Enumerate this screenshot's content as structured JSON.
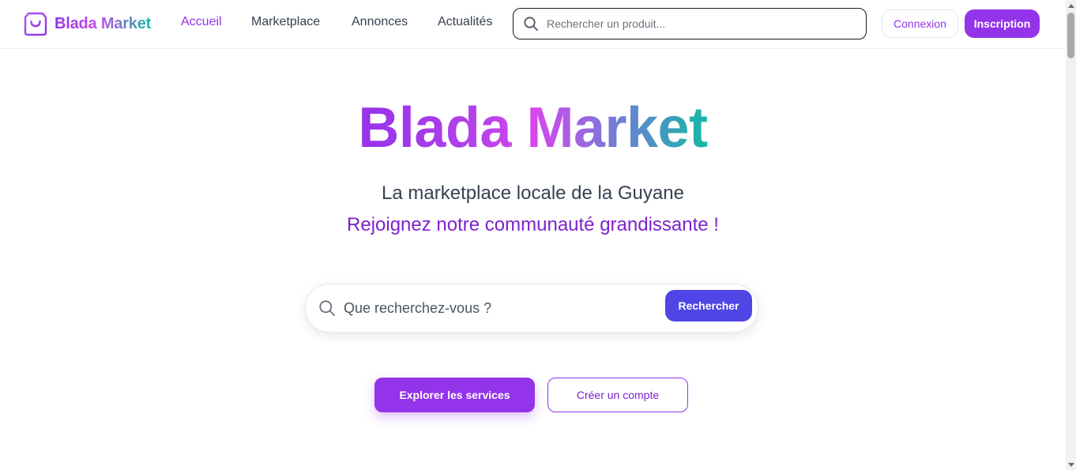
{
  "header": {
    "brand": "Blada Market",
    "nav": {
      "home": "Accueil",
      "marketplace": "Marketplace",
      "listings": "Annonces",
      "news": "Actualités"
    },
    "search": {
      "placeholder": "Rechercher un produit..."
    },
    "login_label": "Connexion",
    "signup_label": "Inscription"
  },
  "hero": {
    "title": "Blada Market",
    "subtitle": "La marketplace locale de la Guyane",
    "tagline": "Rejoignez notre communauté grandissante !",
    "search": {
      "placeholder": "Que recherchez-vous ?",
      "button_label": "Rechercher"
    },
    "explore_label": "Explorer les services",
    "create_account_label": "Créer un compte"
  },
  "icons": {
    "logo": "shopping-bag-icon",
    "search": "search-icon"
  },
  "colors": {
    "brand_purple": "#9333ea",
    "brand_teal": "#14b8a6",
    "search_button": "#4f46e5"
  }
}
